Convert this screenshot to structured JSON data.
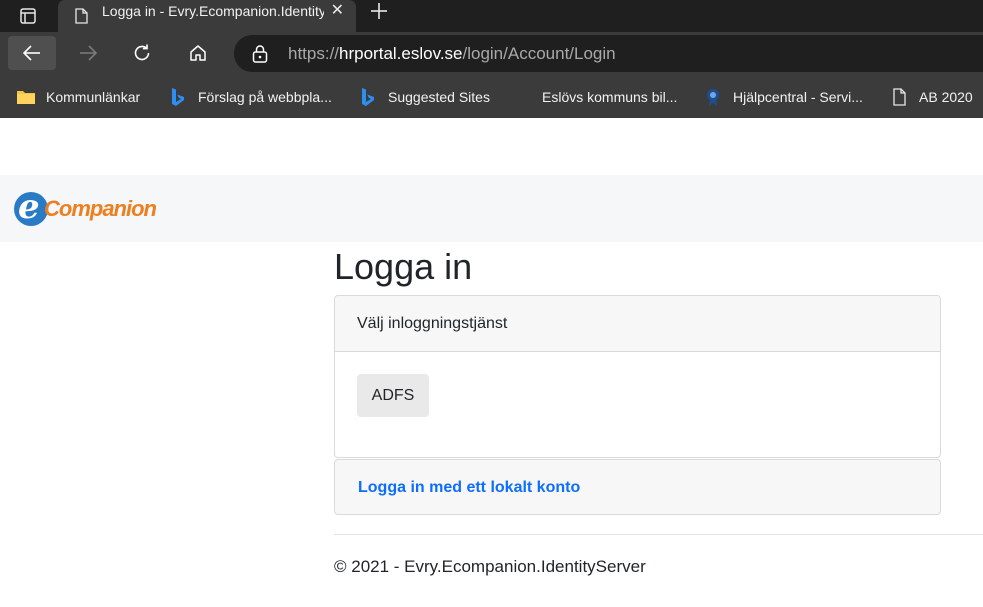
{
  "browser": {
    "tab": {
      "title": "Logga in - Evry.Ecompanion.IdentityServer",
      "close_icon": "close-icon"
    },
    "address_bar": {
      "scheme": "https://",
      "host": "hrportal.eslov.se",
      "path": "/login/Account/Login"
    },
    "bookmarks": [
      {
        "label": "Kommunlänkar",
        "icon": "folder-icon"
      },
      {
        "label": "Förslag på webbpla...",
        "icon": "bing-icon"
      },
      {
        "label": "Suggested Sites",
        "icon": "bing-icon"
      },
      {
        "label": "Eslövs kommuns bil...",
        "icon": "site-icon"
      },
      {
        "label": "Hjälpcentral - Servi...",
        "icon": "help-icon"
      },
      {
        "label": "AB 2020",
        "icon": "page-icon"
      }
    ]
  },
  "header": {
    "logo_letter": "e",
    "logo_text": "Companion"
  },
  "main": {
    "title": "Logga in",
    "card": {
      "header": "Välj inloggningstjänst",
      "button": "ADFS"
    },
    "local_login": "Logga in med ett lokalt konto"
  },
  "footer": {
    "text": "© 2021 - Evry.Ecompanion.IdentityServer"
  },
  "colors": {
    "link": "#0d6efd",
    "logo_blue": "#2a7bc5",
    "logo_orange": "#ee7f1f"
  }
}
